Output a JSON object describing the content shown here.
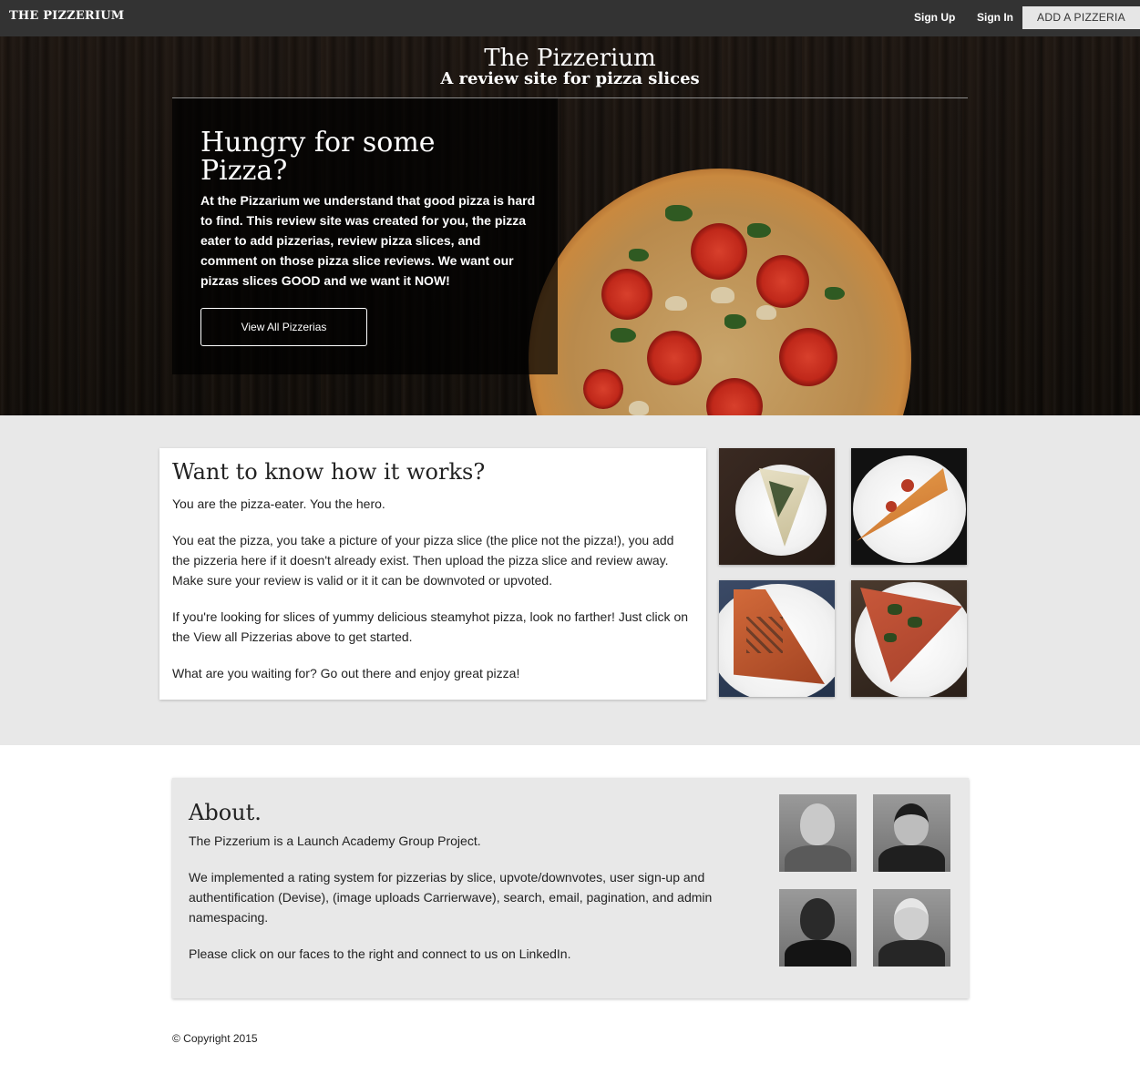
{
  "nav": {
    "brand": "THE PIZZERIUM",
    "sign_up": "Sign Up",
    "sign_in": "Sign In",
    "add_pizzeria": "ADD A PIZZERIA"
  },
  "hero": {
    "title": "The Pizzerium",
    "subtitle": "A review site for pizza slices",
    "heading": "Hungry for some Pizza?",
    "text": "At the Pizzarium we understand that good pizza is hard to find. This review site was created for you, the pizza eater to add pizzerias, review pizza slices, and comment on those pizza slice reviews. We want our pizzas slices GOOD and we want it NOW!",
    "button": "View All Pizzerias"
  },
  "how": {
    "title": "Want to know how it works?",
    "paragraphs": [
      "You are the pizza-eater. You the hero.",
      "You eat the pizza, you take a picture of your pizza slice (the plice not the pizza!), you add the pizzeria here if it doesn't already exist. Then upload the pizza slice and review away. Make sure your review is valid or it it can be downvoted or upvoted.",
      "If you're looking for slices of yummy delicious steamyhot pizza, look no farther! Just click on the View all Pizzerias above to get started.",
      "What are you waiting for? Go out there and enjoy great pizza!"
    ]
  },
  "about": {
    "title": "About.",
    "paragraphs": [
      "The Pizzerium is a Launch Academy Group Project.",
      "We implemented a rating system for pizzerias by slice, upvote/downvotes, user sign-up and authentification (Devise), (image uploads Carrierwave), search, email, pagination, and admin namespacing.",
      "Please click on our faces to the right and connect to us on LinkedIn."
    ]
  },
  "footer": {
    "copyright": "© Copyright 2015"
  },
  "colors": {
    "topbar": "#333333",
    "section_gray": "#e8e8e8",
    "text": "#222222"
  }
}
